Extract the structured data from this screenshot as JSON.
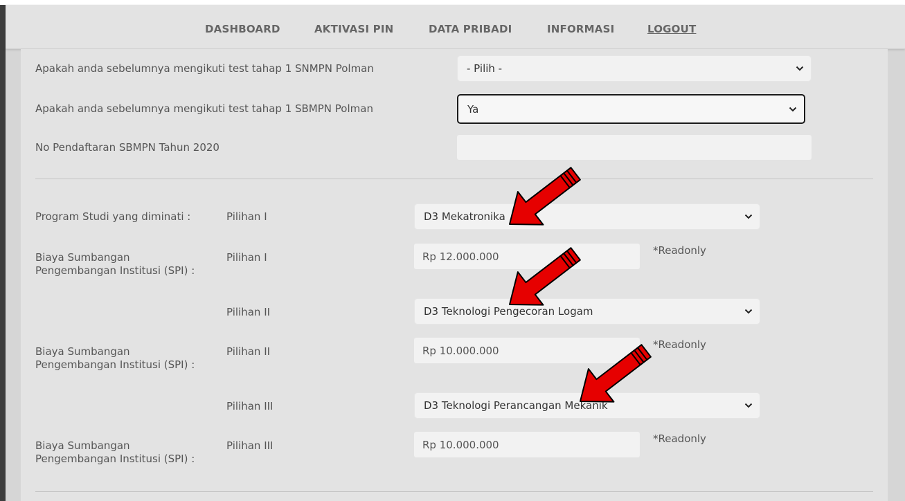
{
  "nav": {
    "items": [
      "DASHBOARD",
      "AKTIVASI PIN",
      "DATA PRIBADI",
      "INFORMASI"
    ],
    "logout": "LOGOUT"
  },
  "form": {
    "q_snmpn": {
      "label": "Apakah anda sebelumnya mengikuti test tahap 1 SNMPN Polman",
      "value": "- Pilih -"
    },
    "q_sbmpn": {
      "label": "Apakah anda sebelumnya mengikuti test tahap 1 SBMPN Polman",
      "value": "Ya"
    },
    "no_pendaftaran": {
      "label": "No Pendaftaran SBMPN Tahun 2020",
      "value": ""
    },
    "program_label": "Program Studi yang diminati :",
    "spi_label_line1": "Biaya Sumbangan",
    "spi_label_line2": "Pengembangan Institusi (SPI) :",
    "readonly_note": "*Readonly",
    "pilihan": [
      {
        "label": "Pilihan I",
        "program": "D3 Mekatronika",
        "spi": "Rp 12.000.000"
      },
      {
        "label": "Pilihan II",
        "program": "D3 Teknologi Pengecoran Logam",
        "spi": "Rp 10.000.000"
      },
      {
        "label": "Pilihan III",
        "program": "D3 Teknologi Perancangan Mekanik",
        "spi": "Rp 10.000.000"
      }
    ]
  },
  "colors": {
    "arrow": "#e60000",
    "panel": "#e3e3e3",
    "nav_text": "#666666"
  },
  "icons": {
    "dropdown": "chevron-down-icon",
    "annotation": "red-arrow-icon"
  }
}
